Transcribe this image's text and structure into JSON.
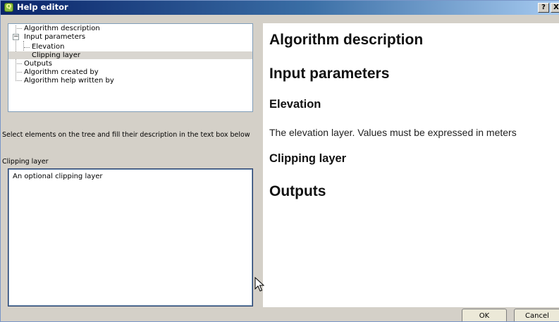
{
  "window": {
    "title": "Help editor",
    "app_icon": "qgis-icon",
    "help_button": "?",
    "close_button": "X"
  },
  "tree": {
    "items": [
      {
        "label": "Algorithm description",
        "level": 1,
        "selected": false
      },
      {
        "label": "Input parameters",
        "level": 1,
        "selected": false,
        "expanded": true
      },
      {
        "label": "Elevation",
        "level": 2,
        "selected": false
      },
      {
        "label": "Clipping layer",
        "level": 2,
        "selected": true
      },
      {
        "label": "Outputs",
        "level": 1,
        "selected": false
      },
      {
        "label": "Algorithm created by",
        "level": 1,
        "selected": false
      },
      {
        "label": "Algorithm help written by",
        "level": 1,
        "selected": false
      }
    ],
    "expander_symbol": "−"
  },
  "instruction": "Select elements on the tree and fill their description in the text box below",
  "field_label": "Clipping layer",
  "description_value": "An optional clipping layer",
  "preview": {
    "heading_algorithm_description": "Algorithm description",
    "heading_input_parameters": "Input parameters",
    "heading_elevation": "Elevation",
    "text_elevation": "The elevation layer. Values must be expressed in meters",
    "heading_clipping_layer": "Clipping layer",
    "heading_outputs": "Outputs"
  },
  "buttons": {
    "ok": "OK",
    "cancel": "Cancel"
  }
}
